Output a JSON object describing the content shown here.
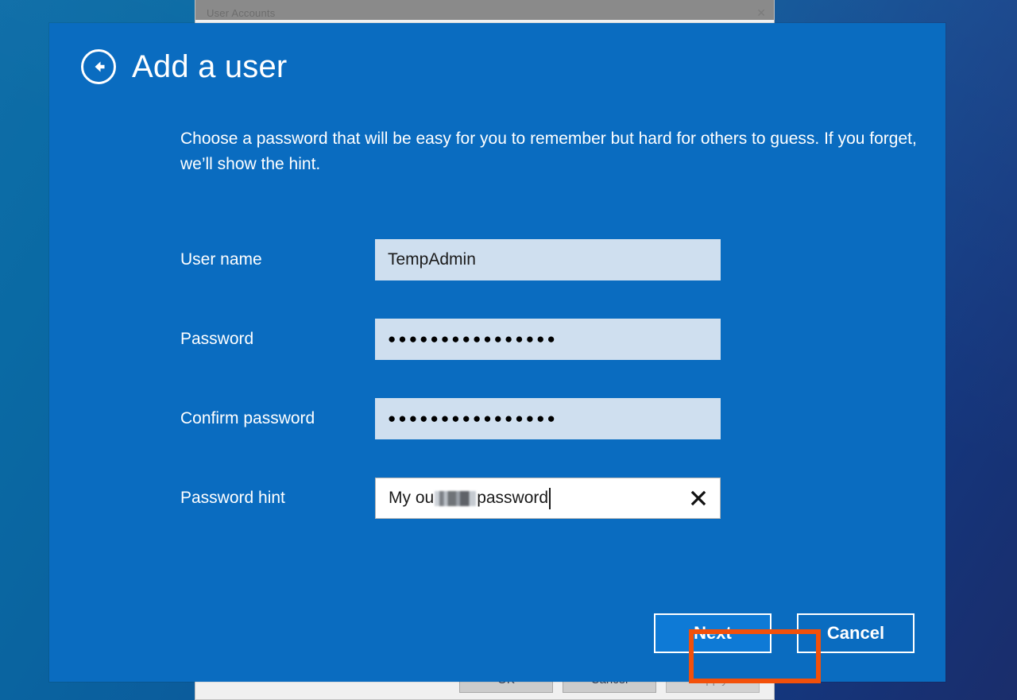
{
  "desktop": {
    "wallpaper_left_color": "#0f6ea8",
    "wallpaper_right_color": "#1a2d6b"
  },
  "background_window": {
    "title": "User Accounts",
    "close_icon": "close-icon",
    "close_glyph": "✕",
    "footer_buttons": [
      {
        "label": "OK",
        "disabled": false
      },
      {
        "label": "Cancel",
        "disabled": false
      },
      {
        "label": "Apply",
        "disabled": true
      }
    ]
  },
  "dialog": {
    "accent_color": "#0a6cc0",
    "back_icon": "back-arrow-icon",
    "title": "Add a user",
    "description": "Choose a password that will be easy for you to remember but hard for others to guess. If you forget, we’ll show the hint.",
    "fields": [
      {
        "label": "User name",
        "name": "user-name",
        "value": "TempAdmin",
        "placeholder": "",
        "type": "text",
        "focused": false,
        "masked": false
      },
      {
        "label": "Password",
        "name": "password",
        "value": "●●●●●●●●●●●●●●●●",
        "placeholder": "",
        "type": "password",
        "focused": false,
        "masked": true,
        "dot_count": 16
      },
      {
        "label": "Confirm password",
        "name": "confirm-password",
        "value": "●●●●●●●●●●●●●●●●",
        "placeholder": "",
        "type": "password",
        "focused": false,
        "masked": true,
        "dot_count": 16
      },
      {
        "label": "Password hint",
        "name": "password-hint",
        "value_prefix": "My ou",
        "value_redacted": true,
        "value_suffix": " password",
        "placeholder": "",
        "type": "text",
        "focused": true,
        "masked": false,
        "clear_icon": "clear-x-icon",
        "clear_glyph": "✕"
      }
    ],
    "buttons": {
      "next_label": "Next",
      "cancel_label": "Cancel"
    },
    "highlight": {
      "target": "next-button",
      "color": "#f2500a"
    }
  }
}
